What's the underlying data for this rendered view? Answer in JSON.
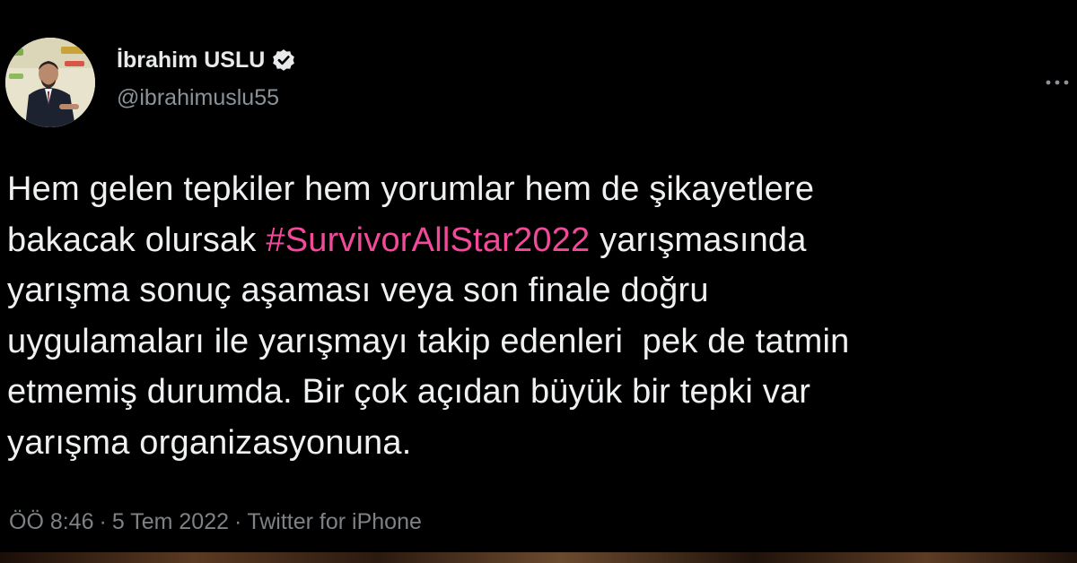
{
  "author": {
    "display_name": "İbrahim USLU",
    "handle": "@ibrahimuslu55",
    "verified": true
  },
  "tweet": {
    "lines": [
      {
        "before": "Hem gelen tepkiler hem yorumlar hem de şikayetlere",
        "hashtag": "",
        "after": ""
      },
      {
        "before": "bakacak olursak ",
        "hashtag": "#SurvivorAllStar2022",
        "after": " yarışmasında"
      },
      {
        "before": "yarışma sonuç aşaması veya son finale doğru",
        "hashtag": "",
        "after": ""
      },
      {
        "before": "uygulamaları ile yarışmayı takip edenleri  pek de tatmin",
        "hashtag": "",
        "after": ""
      },
      {
        "before": "etmemiş durumda. Bir çok açıdan büyük bir tepki var",
        "hashtag": "",
        "after": ""
      },
      {
        "before": "yarışma organizasyonuna.",
        "hashtag": "",
        "after": ""
      }
    ]
  },
  "meta": {
    "time": "ÖÖ 8:46",
    "separator": "·",
    "date": "5 Tem 2022",
    "source": "Twitter for iPhone"
  },
  "colors": {
    "background": "#000000",
    "text": "#e7e9ea",
    "secondary": "#8b9298",
    "hashtag": "#f24a9a"
  },
  "icons": {
    "verified": "verified-badge-icon",
    "more": "more-dots-icon"
  }
}
